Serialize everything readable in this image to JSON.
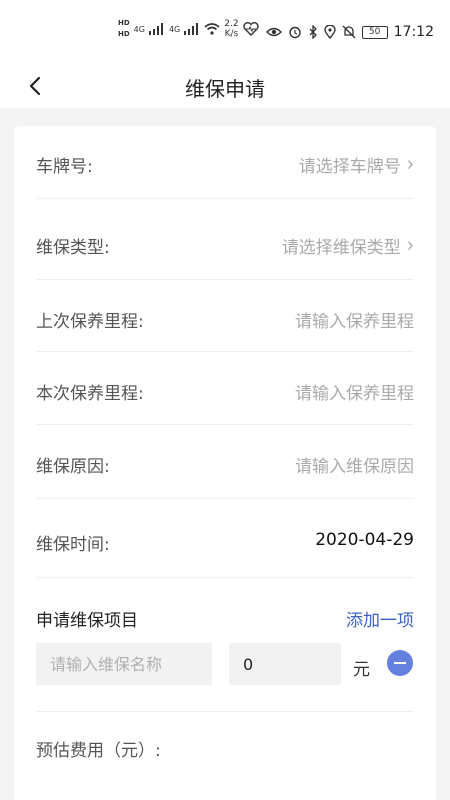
{
  "status_bar": {
    "hd1": "HD",
    "hd2": "HD",
    "net1": "4G",
    "net2": "4G",
    "speed_value": "2.2",
    "speed_unit": "K/s",
    "battery": "50",
    "time": "17:12"
  },
  "header": {
    "title": "维保申请"
  },
  "form": {
    "plate": {
      "label": "车牌号:",
      "value": "请选择车牌号"
    },
    "type": {
      "label": "维保类型:",
      "value": "请选择维保类型"
    },
    "last_mileage": {
      "label": "上次保养里程:",
      "placeholder": "请输入保养里程"
    },
    "current_mileage": {
      "label": "本次保养里程:",
      "placeholder": "请输入保养里程"
    },
    "reason": {
      "label": "维保原因:",
      "placeholder": "请输入维保原因"
    },
    "time": {
      "label": "维保时间:",
      "value": "2020-04-29"
    }
  },
  "items_section": {
    "title": "申请维保项目",
    "add_label": "添加一项",
    "item": {
      "name_placeholder": "请输入维保名称",
      "amount": "0",
      "unit": "元"
    }
  },
  "fee": {
    "label": "预估费用（元）:"
  },
  "colors": {
    "accent": "#3b63c4",
    "minus_button": "#6680e0",
    "background": "#f4f4f4"
  }
}
